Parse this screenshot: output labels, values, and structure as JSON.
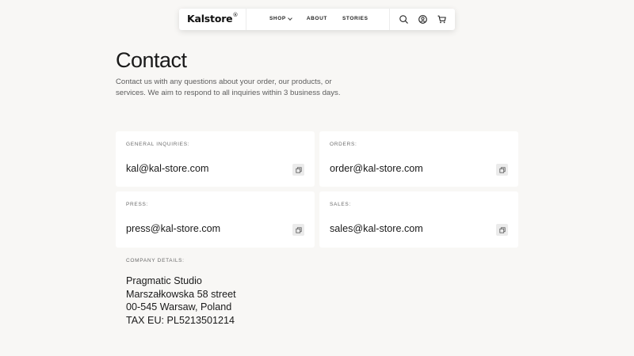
{
  "nav": {
    "brand": "Kalstore",
    "brand_mark": "®",
    "links": [
      {
        "label": "SHOP"
      },
      {
        "label": "ABOUT"
      },
      {
        "label": "STORIES"
      }
    ]
  },
  "page": {
    "title": "Contact",
    "intro": "Contact us with any questions about your order, our products, or services. We aim to respond to all inquiries within 3 business days."
  },
  "contacts": [
    {
      "label": "GENERAL INQUIRIES:",
      "value": "kal@kal-store.com"
    },
    {
      "label": "ORDERS:",
      "value": "order@kal-store.com"
    },
    {
      "label": "PRESS:",
      "value": "press@kal-store.com"
    },
    {
      "label": "SALES:",
      "value": "sales@kal-store.com"
    }
  ],
  "company": {
    "label": "COMPANY DETAILS:",
    "lines": [
      "Pragmatic Studio",
      "Marszałkowska 58 street",
      "00-545 Warsaw, Poland",
      "TAX EU: PL5213501214"
    ]
  },
  "icons": {
    "chevron": "chevron-down-icon",
    "search": "search-icon",
    "account": "user-icon",
    "cart": "cart-icon",
    "copy": "copy-icon"
  },
  "colors": {
    "background": "#f8f7f5",
    "card": "#ffffff",
    "text": "#1a1a1a",
    "muted": "#5d5d5d"
  }
}
